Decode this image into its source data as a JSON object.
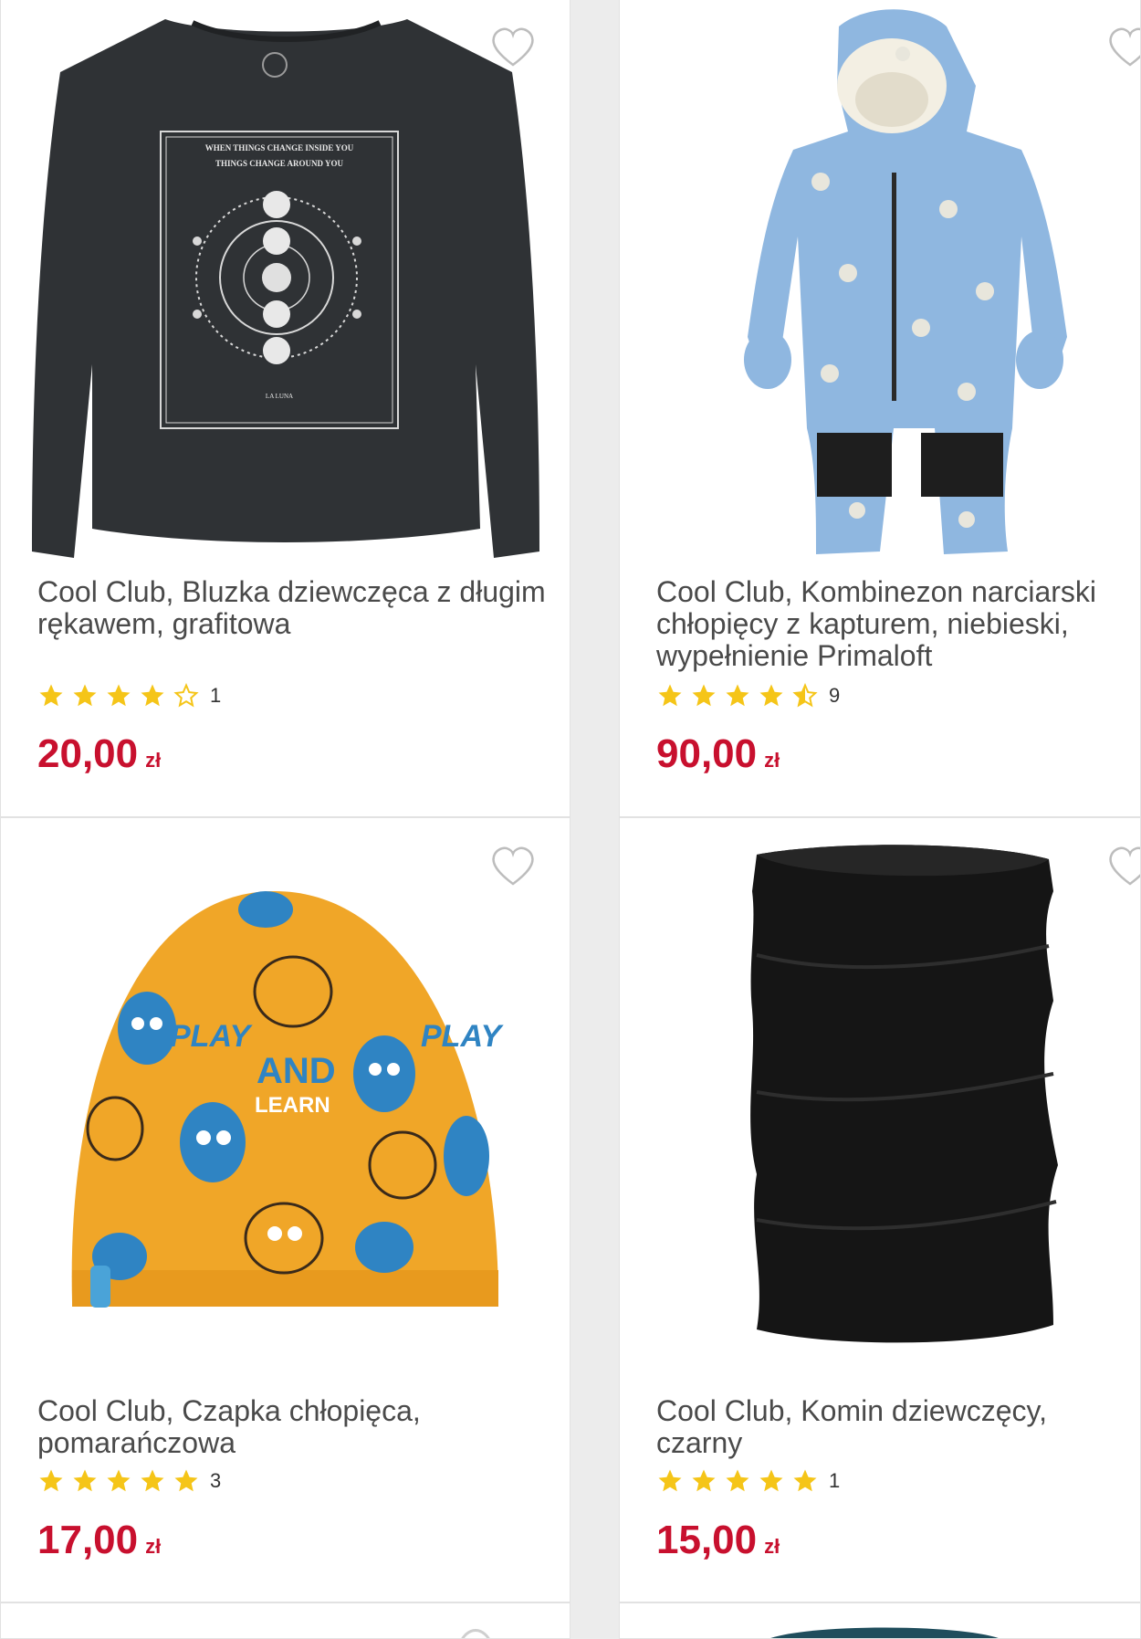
{
  "colors": {
    "price": "#c8102e",
    "star": "#f5c518",
    "title": "#4a4a4a"
  },
  "products": [
    {
      "title": "Cool Club, Bluzka dziewczęca z długim rękawem, grafitowa",
      "rating": 4,
      "reviews": "1",
      "price": "20,00",
      "currency": "zł",
      "print_text": [
        "WHEN THINGS CHANGE INSIDE YOU",
        "THINGS CHANGE AROUND YOU",
        "LA LUNA"
      ]
    },
    {
      "title": "Cool Club, Kombinezon narciarski chłopięcy z kapturem, niebieski, wypełnienie Primaloft",
      "rating": 4.5,
      "reviews": "9",
      "price": "90,00",
      "currency": "zł"
    },
    {
      "title": "Cool Club, Czapka chłopięca, pomarańczowa",
      "rating": 5,
      "reviews": "3",
      "price": "17,00",
      "currency": "zł",
      "print_text": [
        "PLAY",
        "AND",
        "LEARN",
        "PLAY"
      ]
    },
    {
      "title": "Cool Club, Komin dziewczęcy, czarny",
      "rating": 5,
      "reviews": "1",
      "price": "15,00",
      "currency": "zł"
    }
  ]
}
